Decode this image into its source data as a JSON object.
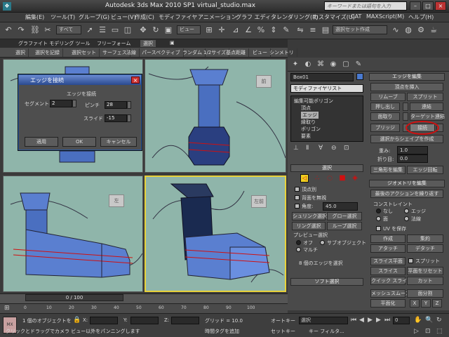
{
  "titlebar": {
    "title": "Autodesk 3ds Max  2010 SP1     virtual_studio.max",
    "search_placeholder": "キーワードまたは語句を入力"
  },
  "menus": [
    "編集(E)",
    "ツール(T)",
    "グループ(G)",
    "ビュー(V)",
    "作成(C)",
    "モディファイヤ",
    "アニメーション",
    "グラフ エディタ",
    "レンダリング(R)",
    "カスタマイズ(U)",
    "CAT",
    "MAXScript(M)",
    "ヘルプ(H)"
  ],
  "toolbar": {
    "filter_label": "すべて",
    "view_label": "ビュー",
    "selection_set": "選択セット作成"
  },
  "ribbon": {
    "tabs": [
      "グラファイト モデリング ツール",
      "フリーフォーム",
      "選択",
      "▣"
    ]
  },
  "subtabs": [
    "選択",
    "選択を記録",
    "選択セット",
    "サーフェス",
    "法線",
    "パースペクティブ",
    "ランダム",
    "1/2サイズ",
    "基点距離",
    "ビュー",
    "シンメトリ"
  ],
  "viewports": {
    "front_cube": "前",
    "left_cube": "左",
    "persp_cube": "左前"
  },
  "dialog": {
    "title": "エッジを接続",
    "group_label": "エッジを接続",
    "segments_label": "セグメント:",
    "segments_value": "2",
    "pinch_label": "ピンチ",
    "pinch_value": "28",
    "slide_label": "スライド",
    "slide_value": "-15",
    "apply": "適用",
    "ok": "OK",
    "cancel": "キャンセル"
  },
  "command_panel": {
    "object_name": "Box01",
    "modifier_list": "モディファイヤリスト",
    "stack": [
      "編集可能ポリゴン",
      "頂点",
      "エッジ",
      "縁取り",
      "ポリゴン",
      "要素"
    ],
    "selected_stack_index": 2,
    "edit_edges": {
      "header": "エッジを編集",
      "insert_vertex": "頂点を挿入",
      "remove": "リムーブ",
      "split": "スプリット",
      "extrude": "押し出し",
      "weld": "連結",
      "chamfer": "面取り",
      "target_weld": "ターゲット連結",
      "bridge": "ブリッジ",
      "connect": "接続",
      "create_shape": "選択からシェイプを作成",
      "weight_label": "重み:",
      "weight_value": "1.0",
      "crease_label": "折り目:",
      "crease_value": "0.0",
      "edit_tri": "三角形を編集",
      "turn": "エッジ回転"
    },
    "selection": {
      "header": "選択",
      "by_vertex": "頂点別",
      "ignore_backfacing": "背面を無視",
      "angle_label": "角度:",
      "angle_value": "45.0",
      "shrink": "シュリンク選択",
      "grow": "グロー選択",
      "ring": "リング選択",
      "loop": "ループ選択",
      "preview_label": "プレビュー選択",
      "off": "オフ",
      "subobject": "サブオブジェクト",
      "multi": "マルチ",
      "status": "8 個のエッジを選択"
    },
    "soft_selection": "ソフト選択",
    "geometry": {
      "header": "ジオメトリを編集",
      "repeat_last": "最後のアクションを繰り返す",
      "constraints": "コンストレイント",
      "none": "なし",
      "edge": "エッジ",
      "face": "面",
      "normal": "法線",
      "preserve_uv": "UV を保存",
      "create": "作成",
      "collapse": "集約",
      "attach": "アタッチ",
      "detach": "デタッチ",
      "slice_plane": "スライス平面",
      "split": "スプリット",
      "slice": "スライス",
      "reset_plane": "平面をリセット",
      "quickslice": "クイック スライス",
      "cut": "カット",
      "meshsmooth": "メッシュスムーズ",
      "tessellate": "面分割",
      "planarize": "平面化",
      "x": "X",
      "y": "Y",
      "z": "Z"
    }
  },
  "timeline": {
    "slider": "0 / 100",
    "ticks": [
      "0",
      "10",
      "20",
      "30",
      "40",
      "50",
      "60",
      "70",
      "80",
      "90",
      "100"
    ]
  },
  "status": {
    "selection": "1 個のオブジェクトを",
    "x_label": "X:",
    "y_label": "Y:",
    "z_label": "Z:",
    "grid": "グリッド = 10.0",
    "autokey": "オートキー",
    "setkey": "セットキー",
    "filter": "キー フィルタ...",
    "selected": "選択",
    "prompt": "クリックとドラッグでカメラ ビュー以外をパンニングします",
    "add_time_tag": "時間タグを追加",
    "frame": "0"
  }
}
